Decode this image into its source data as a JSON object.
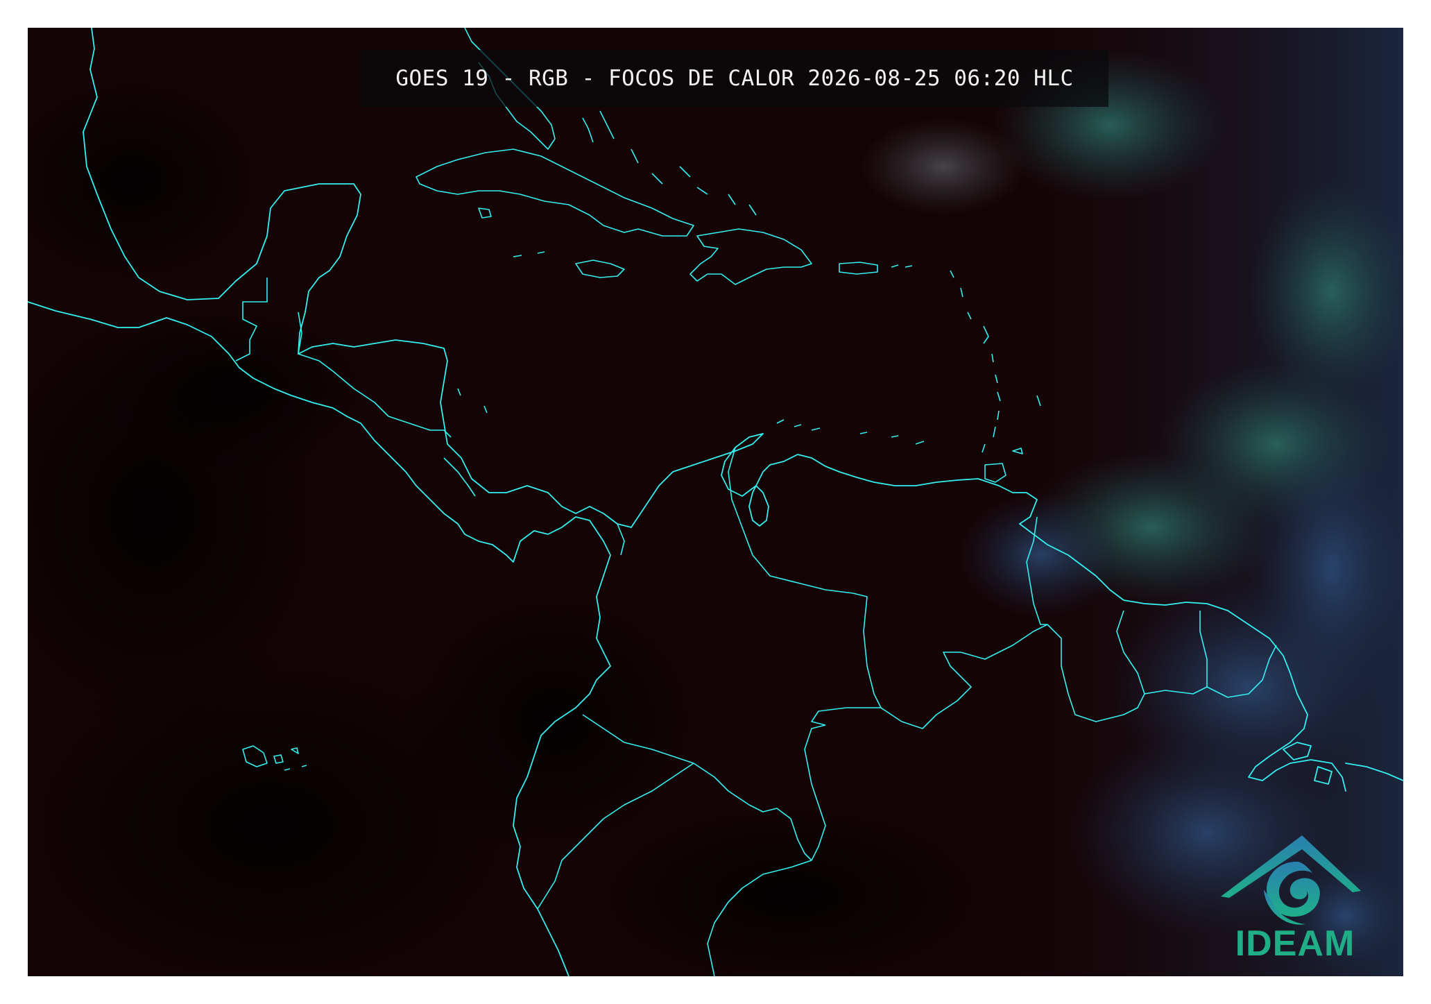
{
  "title": "GOES 19 - RGB - FOCOS DE CALOR 2026-08-25 06:20 HLC",
  "logo": {
    "text": "IDEAM"
  },
  "colors": {
    "background": "#140406",
    "coastline": "#35f0f0",
    "logo_accent": "#1fae86",
    "cloud": "#1f5a55",
    "high_cloud": "#2a3d66"
  },
  "map": {
    "region": "Caribbean, Central America and northern South America",
    "features": [
      "coastlines",
      "country-borders"
    ]
  }
}
